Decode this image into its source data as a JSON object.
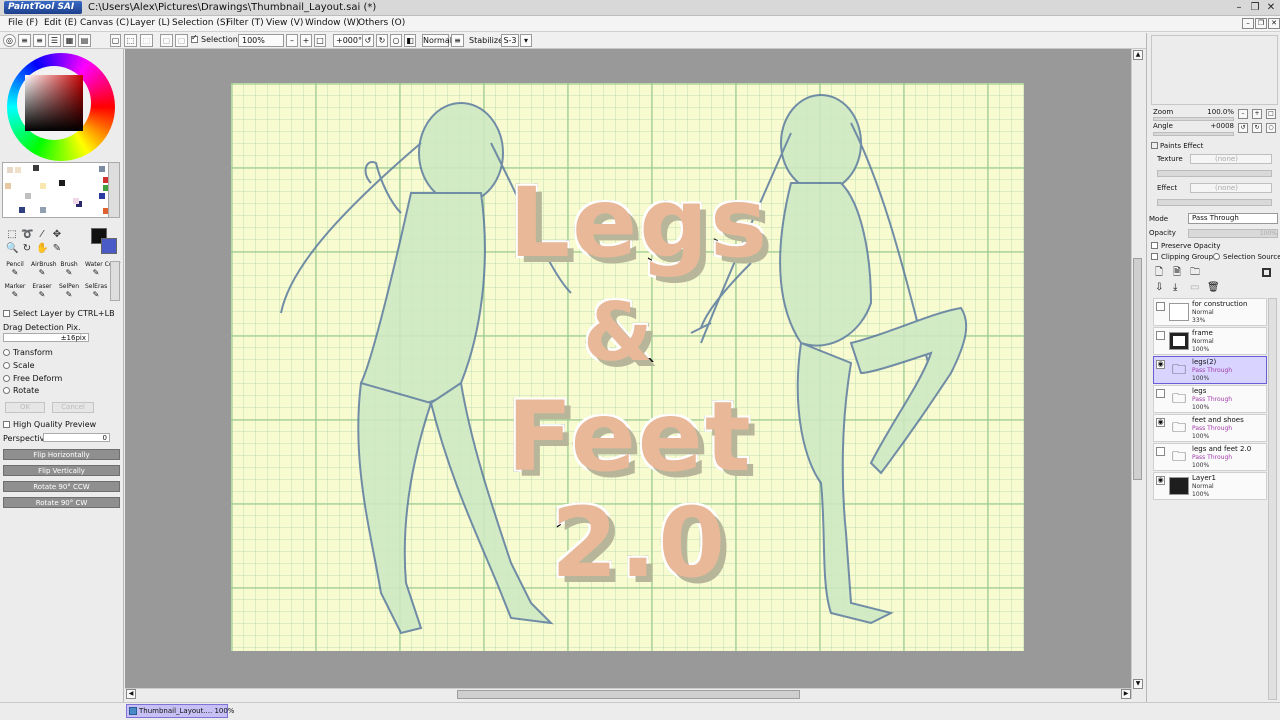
{
  "window": {
    "app_logo": "PaintTool SAI",
    "title": "C:\\Users\\Alex\\Pictures\\Drawings\\Thumbnail_Layout.sai (*)",
    "minimize": "–",
    "restore": "❐",
    "close": "✕"
  },
  "menu": [
    "File (F)",
    "Edit (E)",
    "Canvas (C)",
    "Layer (L)",
    "Selection (S)",
    "Filter (T)",
    "View (V)",
    "Window (W)",
    "Others (O)"
  ],
  "toolbar": {
    "selection_label": "Selection",
    "zoom": "100%",
    "angle": "+000°",
    "blend": "Normal",
    "stabilizer_label": "Stabilizer",
    "stabilizer_value": "S-3"
  },
  "colors": {
    "accent_selected": "#d8d4ff",
    "pass_through": "#a03aa8",
    "canvas_bg": "#f8fbcf",
    "title_fill": "#e8b898",
    "primary_color": "#111111",
    "secondary_color": "#4a5bc8"
  },
  "swatches": [
    "#e8d8c8",
    "#f0e0c8",
    "#3a3a3a",
    "#7a8aa0",
    "#2a2a6a",
    "#d03030",
    "#f8e8b0",
    "#1a1a1a",
    "#40a040",
    "#e8c8a0",
    "#90a0b0",
    "#2a3aa0",
    "#e06030",
    "#f0d8e8",
    "#304080",
    "#c0c0c0"
  ],
  "tools": {
    "icons": [
      "marquee-icon",
      "lasso-icon",
      "magic-wand-icon",
      "move-icon",
      "zoom-icon",
      "rotate-icon",
      "hand-icon",
      "eyedropper-icon"
    ],
    "brushes": [
      {
        "label": "Pencil"
      },
      {
        "label": "AirBrush"
      },
      {
        "label": "Brush"
      },
      {
        "label": "Water Color"
      },
      {
        "label": "Marker"
      },
      {
        "label": "Eraser"
      },
      {
        "label": "SelPen"
      },
      {
        "label": "SelEras"
      }
    ]
  },
  "options": {
    "select_layer": "Select Layer by CTRL+LB",
    "drag_detection": "Drag Detection Pix.",
    "drag_value": "±16pix",
    "transform": "Transform",
    "scale": "Scale",
    "free_deform": "Free Deform",
    "rotate": "Rotate",
    "ok": "OK",
    "cancel": "Cancel",
    "hq_preview": "High Quality Preview",
    "perspective": "Perspective",
    "perspective_value": "0",
    "flip_h": "Flip Horizontally",
    "flip_v": "Flip Vertically",
    "rot_ccw": "Rotate 90° CCW",
    "rot_cw": "Rotate 90° CW"
  },
  "artwork": {
    "line1": "Legs",
    "line2": "&",
    "line3": "Feet",
    "line4": "2.0"
  },
  "status": {
    "doc_tab": "Thumbnail_Layout.... 100%"
  },
  "navigator": {
    "zoom_label": "Zoom",
    "zoom_value": "100.0%",
    "angle_label": "Angle",
    "angle_value": "+0008"
  },
  "layer_panel": {
    "paints_effect": "Paints Effect",
    "texture_label": "Texture",
    "texture_value": "(none)",
    "effect_label": "Effect",
    "effect_value": "(none)",
    "mode_label": "Mode",
    "mode_value": "Pass Through",
    "opacity_label": "Opacity",
    "opacity_value": "100%",
    "preserve_opacity": "Preserve Opacity",
    "clipping_group": "Clipping Group",
    "selection_source": "Selection Source"
  },
  "layers": [
    {
      "name": "for construction",
      "mode": "Normal",
      "opacity": "33%",
      "visible": false,
      "folder": false,
      "selected": false,
      "pass": false
    },
    {
      "name": "frame",
      "mode": "Normal",
      "opacity": "100%",
      "visible": false,
      "folder": false,
      "selected": false,
      "pass": false
    },
    {
      "name": "legs(2)",
      "mode": "Pass Through",
      "opacity": "100%",
      "visible": true,
      "folder": true,
      "selected": true,
      "pass": true
    },
    {
      "name": "legs",
      "mode": "Pass Through",
      "opacity": "100%",
      "visible": false,
      "folder": true,
      "selected": false,
      "pass": true
    },
    {
      "name": "feet and shoes",
      "mode": "Pass Through",
      "opacity": "100%",
      "visible": true,
      "folder": true,
      "selected": false,
      "pass": true
    },
    {
      "name": "legs and feet 2.0",
      "mode": "Pass Through",
      "opacity": "100%",
      "visible": false,
      "folder": true,
      "selected": false,
      "pass": true
    },
    {
      "name": "Layer1",
      "mode": "Normal",
      "opacity": "100%",
      "visible": true,
      "folder": false,
      "selected": false,
      "pass": false
    }
  ]
}
